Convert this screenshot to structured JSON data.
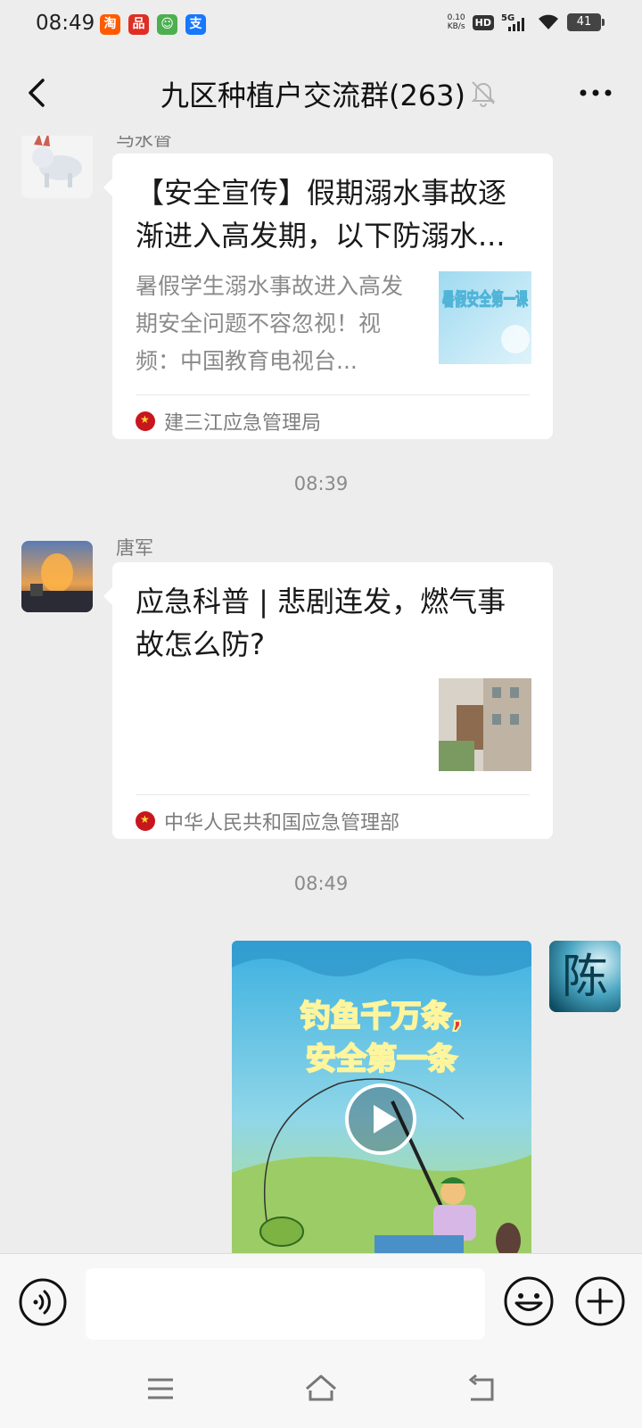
{
  "status_bar": {
    "time": "08:49",
    "apps": [
      {
        "icon": "taobao-app-icon",
        "glyph": "淘",
        "color": "#ff5a00"
      },
      {
        "icon": "pinduoduo-app-icon",
        "glyph": "品",
        "color": "#e02e24"
      },
      {
        "icon": "kids-app-icon",
        "glyph": "☺",
        "color": "#4caf50"
      },
      {
        "icon": "alipay-app-icon",
        "glyph": "支",
        "color": "#1677ff"
      }
    ],
    "net_speed": "0.10",
    "net_unit": "KB/s",
    "hd": "HD",
    "network": "5G",
    "battery": "41"
  },
  "header": {
    "title": "九区种植户交流群(263)"
  },
  "messages": [
    {
      "sender": "马永督",
      "card": {
        "title": "【安全宣传】假期溺水事故逐渐进入高发期，以下防溺水...",
        "desc": "暑假学生溺水事故进入高发期安全问题不容忽视！视频：中国教育电视台...",
        "thumb_text": "暑假安全第一课",
        "source": "建三江应急管理局"
      }
    },
    {
      "timestamp": "08:39",
      "sender": "唐军",
      "card": {
        "title": "应急科普 | 悲剧连发，燃气事故怎么防?",
        "source": "中华人民共和国应急管理部"
      }
    },
    {
      "timestamp": "08:49",
      "self_avatar_text": "陈",
      "video": {
        "caption_line1": "钓鱼千万条,",
        "caption_line2": "安全第一条"
      }
    }
  ],
  "input": {
    "value": ""
  },
  "colors": {
    "background": "#ededed",
    "bubble": "#ffffff",
    "meta_text": "#8a8a8a"
  }
}
